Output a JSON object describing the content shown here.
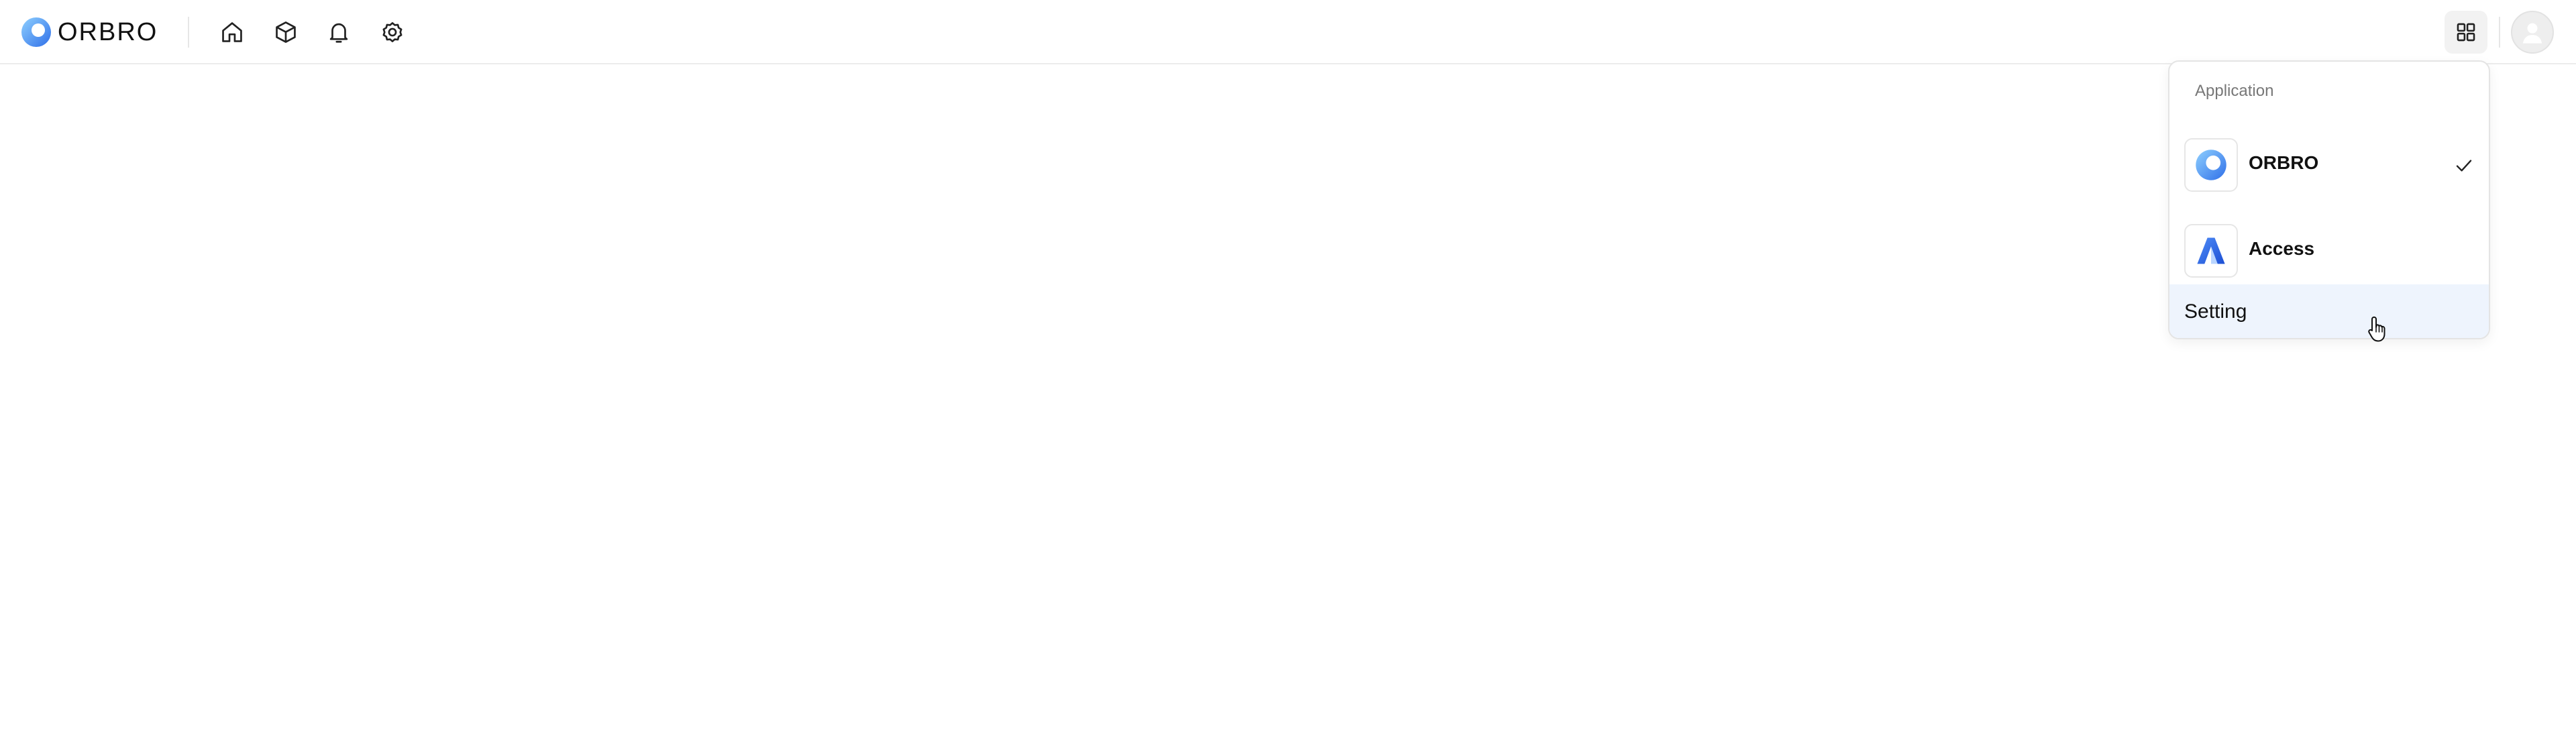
{
  "header": {
    "logo_text": "ORBRO",
    "nav_icons": [
      "home-icon",
      "box-icon",
      "bell-icon",
      "gear-icon"
    ],
    "apps_icon": "grid-icon",
    "avatar_icon": "user-icon"
  },
  "app_menu": {
    "heading": "Application",
    "items": [
      {
        "label": "ORBRO",
        "icon": "orbro-app-icon",
        "selected": true
      },
      {
        "label": "Access",
        "icon": "access-app-icon",
        "selected": false
      }
    ],
    "setting_label": "Setting"
  },
  "colors": {
    "brand_blue": "#2f7bf0",
    "brand_light_blue": "#6fb3ff",
    "hover_bg": "#eef4fd",
    "border": "#e4e4e4"
  }
}
